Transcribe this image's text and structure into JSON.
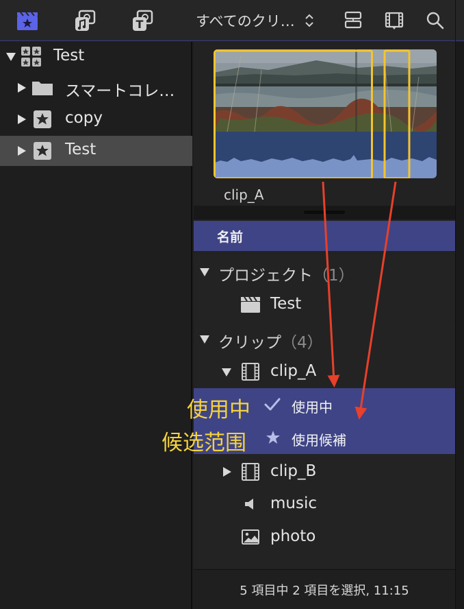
{
  "toolbar": {
    "icons": [
      "libraries-icon",
      "photos-audio-icon",
      "titles-generators-icon"
    ],
    "filter_label": "すべてのクリ…",
    "right_icons": [
      "clip-appearance-icon",
      "filmstrip-view-icon",
      "search-icon"
    ],
    "accent_color": "#5b63e8"
  },
  "sidebar": {
    "library": {
      "label": "Test",
      "icon": "library-icon"
    },
    "items": [
      {
        "label": "スマートコレ…",
        "icon": "folder-icon"
      },
      {
        "label": "copy",
        "icon": "event-star-icon"
      },
      {
        "label": "Test",
        "icon": "event-star-icon",
        "selected": true
      }
    ]
  },
  "browser": {
    "clip_name": "clip_A",
    "column_header": "名前",
    "groups": [
      {
        "label": "プロジェクト",
        "count": "（1）"
      },
      {
        "label": "クリップ",
        "count": "（4）"
      }
    ],
    "project": {
      "label": "Test",
      "icon": "clapperboard-icon"
    },
    "clips": [
      {
        "label": "clip_A",
        "icon": "film-icon"
      },
      {
        "label": "clip_B",
        "icon": "film-icon"
      },
      {
        "label": "music",
        "icon": "speaker-icon"
      },
      {
        "label": "photo",
        "icon": "image-icon"
      }
    ],
    "ranges": [
      {
        "label": "使用中",
        "icon": "checkmark-icon"
      },
      {
        "label": "使用候補",
        "icon": "star-icon"
      }
    ],
    "status": "5 項目中 2 項目を選択, 11:15",
    "highlight_color": "#3f4486"
  },
  "annotations": {
    "used": "使用中",
    "candidate": "候选范围",
    "box_color": "#f4c430",
    "arrow_color": "#e8402a"
  }
}
